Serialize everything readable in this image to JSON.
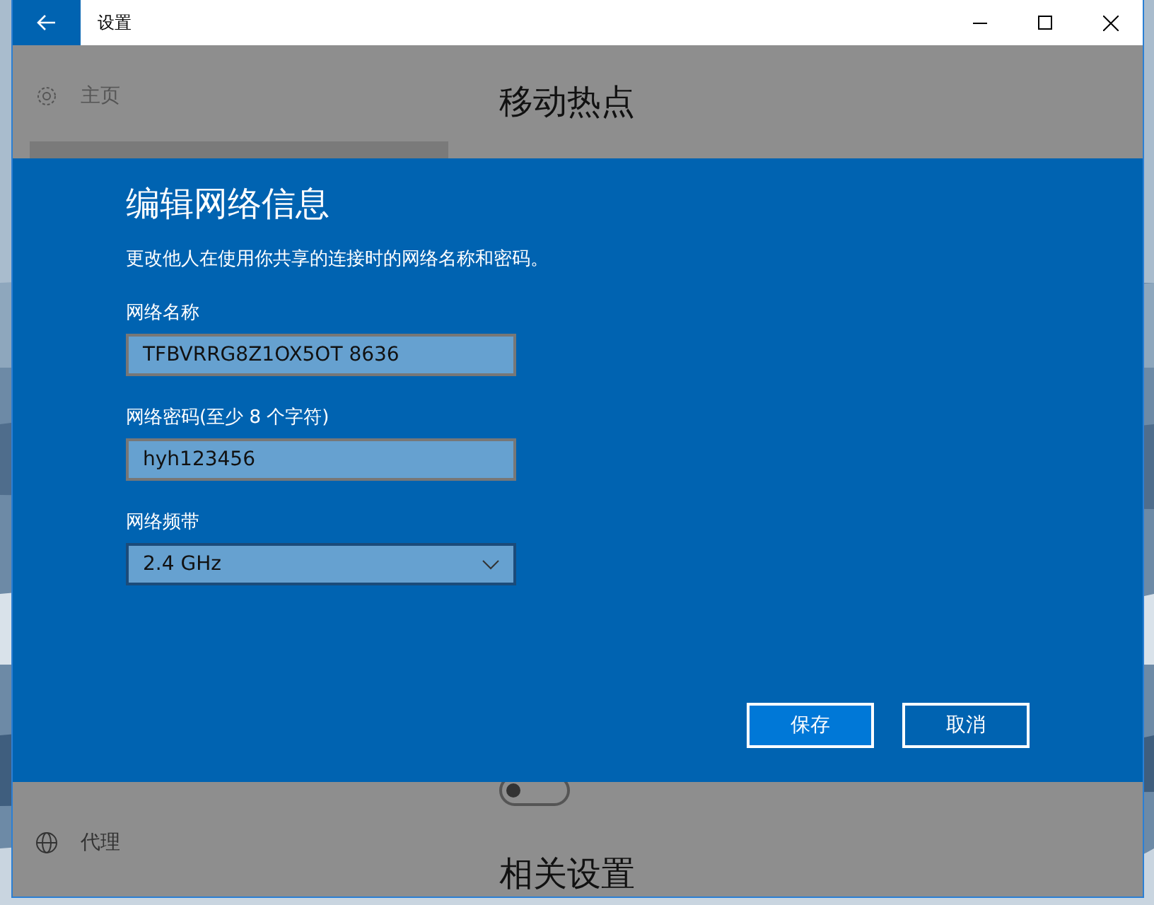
{
  "window": {
    "title": "设置"
  },
  "sidebar": {
    "items": [
      {
        "label": "主页",
        "kind": "home"
      },
      {
        "label": "代理",
        "kind": "proxy"
      }
    ]
  },
  "page": {
    "title": "移动热点",
    "toggle": {
      "on": false
    },
    "section_title": "相关设置"
  },
  "dialog": {
    "title": "编辑网络信息",
    "description": "更改他人在使用你共享的连接时的网络名称和密码。",
    "fields": [
      {
        "label": "网络名称",
        "value": "TFBVRRG8Z1OX5OT 8636",
        "kind": "text"
      },
      {
        "label": "网络密码(至少 8 个字符)",
        "value": "hyh123456",
        "kind": "text"
      },
      {
        "label": "网络频带",
        "value": "2.4 GHz",
        "kind": "dropdown"
      }
    ],
    "buttons": [
      {
        "label": "保存",
        "kind": "primary"
      },
      {
        "label": "取消",
        "kind": "secondary"
      }
    ]
  }
}
